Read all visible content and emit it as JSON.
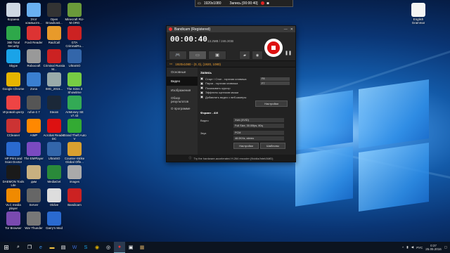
{
  "desktop": {
    "icons": [
      {
        "label": "Корзина",
        "color": "#cfd8e3"
      },
      {
        "label": "Этот компьюте...",
        "color": "#6ab0f0"
      },
      {
        "label": "Open Broadcast...",
        "color": "#333"
      },
      {
        "label": "Minecraft RU-M.ORG",
        "color": "#6a9a3a"
      },
      {
        "label": "360 Total Security",
        "color": "#2ea84a"
      },
      {
        "label": "Foxit Reader",
        "color": "#d33"
      },
      {
        "label": "RaidCall",
        "color": "#e89a2a"
      },
      {
        "label": "GTA CriminalRu...",
        "color": "#c22"
      },
      {
        "label": "Skype",
        "color": "#1aa3e8"
      },
      {
        "label": "Robocraft",
        "color": "#999"
      },
      {
        "label": "Criminal Russia M...",
        "color": "#c22"
      },
      {
        "label": "UltraISO",
        "color": "#3366aa"
      },
      {
        "label": "Google Chrome",
        "color": "#e6b400"
      },
      {
        "label": "Zona",
        "color": "#3a7fd0"
      },
      {
        "label": "IMG_2015...",
        "color": "#9aa"
      },
      {
        "label": "The Sims 3 Showtime",
        "color": "#7c4"
      },
      {
        "label": "Игровой центр",
        "color": "#e44"
      },
      {
        "label": "rufus-2.7",
        "color": "#555"
      },
      {
        "label": "Steam",
        "color": "#1b2838"
      },
      {
        "label": "AnMoney SE v7.43",
        "color": "#3a5"
      },
      {
        "label": "CCleaner",
        "color": "#c33"
      },
      {
        "label": "AIMP",
        "color": "#f80"
      },
      {
        "label": "Acrobat Reader DC",
        "color": "#d11"
      },
      {
        "label": "Grand Theft Auto V",
        "color": "#3a3"
      },
      {
        "label": "HP Print and Scan Doctor",
        "color": "#2a6ad0"
      },
      {
        "label": "The EMPlayer",
        "color": "#7a4ac0"
      },
      {
        "label": "UltraISO",
        "color": "#3366aa"
      },
      {
        "label": "Counter-Strike Global Offe...",
        "color": "#d8a030"
      },
      {
        "label": "DAEMON Tools Lite",
        "color": "#1a1a1a"
      },
      {
        "label": "дим",
        "color": "#c8b080"
      },
      {
        "label": "MediaGet",
        "color": "#2a8a3a"
      },
      {
        "label": "images",
        "color": "#aaa"
      },
      {
        "label": "VLC media player",
        "color": "#f08a00"
      },
      {
        "label": "Server",
        "color": "#666"
      },
      {
        "label": "Oldive",
        "color": "#ddd"
      },
      {
        "label": "Bandicam",
        "color": "#c22"
      },
      {
        "label": "Tor Browser",
        "color": "#7a4ab0"
      },
      {
        "label": "War Thunder",
        "color": "#777"
      },
      {
        "label": "Garry's Mod",
        "color": "#2a6ad0"
      }
    ],
    "right_icon": {
      "label": "English Grammar",
      "color": "#f4f4f4"
    }
  },
  "recbar": {
    "resolution": "1920x1080",
    "status": "Запись [00:00:40]"
  },
  "bandicam": {
    "title": "Bandicam (Registered)",
    "timer": "00:00:40",
    "size": "13.2MB / 246.3GB",
    "target": "1920x1080 - (0, 0), (1920, 1080)",
    "menu": [
      {
        "label": "Основные"
      },
      {
        "label": "Видео"
      },
      {
        "label": "Изображения"
      },
      {
        "label": "Обзор результатов"
      },
      {
        "label": "О программе"
      }
    ],
    "record_header": "Запись",
    "options": [
      {
        "label": "Старт / Стоп - горячая клавиша",
        "value": "F8"
      },
      {
        "label": "Пауза - горячая клавиша",
        "value": "F7"
      },
      {
        "label": "Показывать курсор",
        "value": ""
      },
      {
        "label": "Эффекты щелчков мыши",
        "value": ""
      },
      {
        "label": "Добавлять видео с веб-камеры",
        "value": ""
      }
    ],
    "settings_button": "Настройки",
    "format_label": "Формат - AVI",
    "video_label": "Видео",
    "video_codec": "Xvid (XVID)",
    "video_details": "Full Size, 30.00fps, 80q",
    "audio_label": "Звук",
    "audio_codec": "PCM",
    "audio_details": "48.0KHz, stereo",
    "settings_button2": "Настройки",
    "templates_button": "Шаблоны",
    "footer": "Try the hardware-accelerated H.264 encoder (Nvidia/Intel/AMD)"
  },
  "taskbar": {
    "start": "⊞",
    "lang": "РУС",
    "time": "0:37",
    "date": "25.05.2016"
  }
}
